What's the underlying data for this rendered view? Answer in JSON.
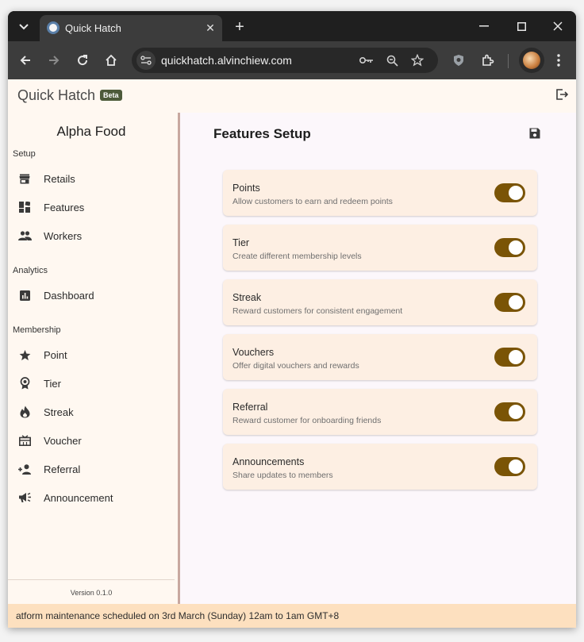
{
  "browser": {
    "tab_title": "Quick Hatch",
    "url": "quickhatch.alvinchiew.com"
  },
  "app": {
    "brand": "Quick Hatch",
    "badge": "Beta",
    "org_name": "Alpha Food",
    "version": "Version 0.1.0",
    "banner": "atform maintenance scheduled on 3rd March (Sunday) 12am to 1am GMT+8"
  },
  "sidebar": {
    "sections": [
      {
        "label": "Setup",
        "items": [
          {
            "label": "Retails",
            "icon": "store-icon"
          },
          {
            "label": "Features",
            "icon": "dashboard-tiles-icon"
          },
          {
            "label": "Workers",
            "icon": "people-icon"
          }
        ]
      },
      {
        "label": "Analytics",
        "items": [
          {
            "label": "Dashboard",
            "icon": "chart-icon"
          }
        ]
      },
      {
        "label": "Membership",
        "items": [
          {
            "label": "Point",
            "icon": "star-icon"
          },
          {
            "label": "Tier",
            "icon": "medal-icon"
          },
          {
            "label": "Streak",
            "icon": "flame-icon"
          },
          {
            "label": "Voucher",
            "icon": "voucher-icon"
          },
          {
            "label": "Referral",
            "icon": "add-person-icon"
          },
          {
            "label": "Announcement",
            "icon": "megaphone-icon"
          }
        ]
      }
    ]
  },
  "main": {
    "title": "Features Setup",
    "features": [
      {
        "title": "Points",
        "desc": "Allow customers to earn and redeem points",
        "enabled": true
      },
      {
        "title": "Tier",
        "desc": "Create different membership levels",
        "enabled": true
      },
      {
        "title": "Streak",
        "desc": "Reward customers for consistent engagement",
        "enabled": true
      },
      {
        "title": "Vouchers",
        "desc": "Offer digital vouchers and rewards",
        "enabled": true
      },
      {
        "title": "Referral",
        "desc": "Reward customer for onboarding friends",
        "enabled": true
      },
      {
        "title": "Announcements",
        "desc": "Share updates to members",
        "enabled": true
      }
    ]
  },
  "colors": {
    "toggle_on": "#7a5406",
    "card_bg": "#fdefe3",
    "banner_bg": "#fde0bf",
    "app_bg": "#fff8f1"
  }
}
